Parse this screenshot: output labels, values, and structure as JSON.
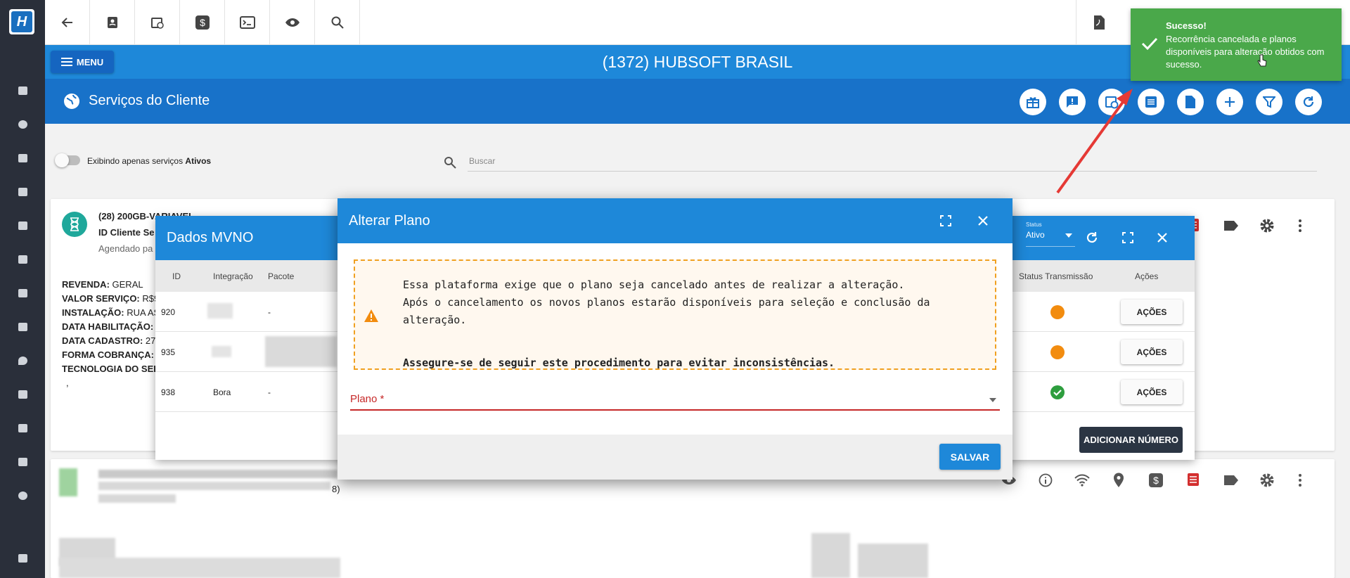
{
  "header": {
    "client_title": "(1372) HUBSOFT BRASIL",
    "menu_label": "MENU"
  },
  "subheader": {
    "title": "Serviços do Cliente"
  },
  "filters": {
    "toggle_text": "Exibindo apenas serviços ",
    "toggle_bold": "Ativos",
    "search_placeholder": "Buscar"
  },
  "service_card": {
    "name": "(28) 200GB-VARIAVEL",
    "client_id": "ID Cliente Se",
    "scheduled": "Agendado pa",
    "details": [
      {
        "label": "REVENDA:",
        "value": " GERAL"
      },
      {
        "label": "VALOR SERVIÇO:",
        "value": " R$9"
      },
      {
        "label": "INSTALAÇÃO:",
        "value": " RUA AS"
      },
      {
        "label": "DATA HABILITAÇÃO:",
        "value": ""
      },
      {
        "label": "DATA CADASTRO:",
        "value": " 27"
      },
      {
        "label": "FORMA COBRANÇA:",
        "value": ""
      },
      {
        "label": "TECNOLOGIA DO SER",
        "value": ""
      }
    ],
    "extra": ",",
    "second_card_suffix": "8)"
  },
  "mvno": {
    "title": "Dados MVNO",
    "status_label": "Status",
    "status_value": "Ativo",
    "columns": [
      "ID",
      "Integração",
      "Pacote",
      "Status Transmissão",
      "Ações"
    ],
    "rows": [
      {
        "id": "920",
        "integracao": "",
        "pacote": "-",
        "status_color": "#f28c0f",
        "action": "AÇÕES"
      },
      {
        "id": "935",
        "integracao": "",
        "pacote": "",
        "status_color": "#f28c0f",
        "action": "AÇÕES"
      },
      {
        "id": "938",
        "integracao": "Bora",
        "pacote": "-",
        "status_color": "#2e9e3e",
        "action": "AÇÕES"
      }
    ],
    "add_button": "ADICIONAR NÚMERO"
  },
  "dialog": {
    "title": "Alterar Plano",
    "warning_lines": [
      "Essa plataforma exige que o plano seja cancelado antes de realizar a alteração.",
      "Após o cancelamento os novos planos estarão disponíveis para seleção e conclusão da",
      "alteração."
    ],
    "warning_bold": "Assegure-se de seguir este procedimento para evitar inconsistências.",
    "plano_label": "Plano *",
    "save_label": "SALVAR"
  },
  "toast": {
    "title": "Sucesso!",
    "message": "Recorrência cancelada e planos disponíveis para alteração obtidos com sucesso."
  },
  "colors": {
    "primary": "#1e88d9",
    "primary_dark": "#1872c9",
    "sidebar": "#2a2f3a",
    "success": "#4aa84a",
    "error": "#c62828",
    "warning": "#f0a020"
  }
}
